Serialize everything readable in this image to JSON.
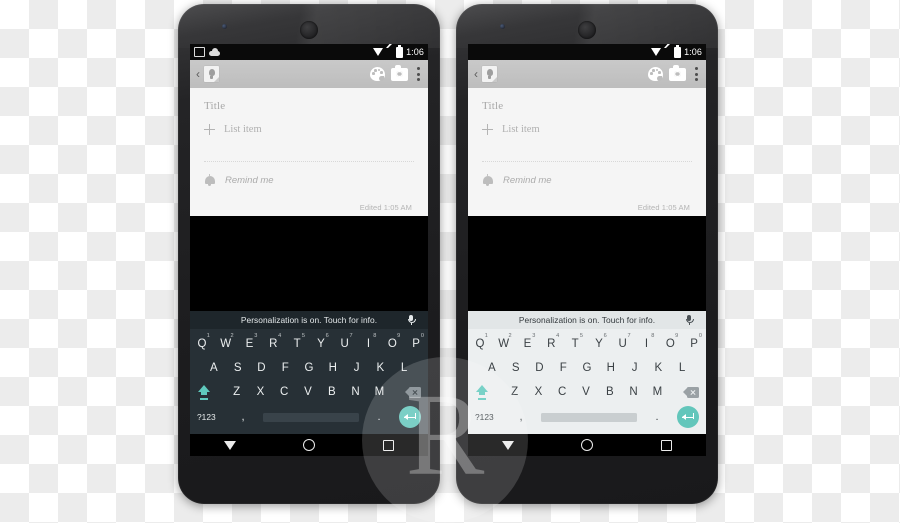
{
  "scene": {
    "description": "Two Android Nexus phones side by side showing Google Keep note editor with keyboard",
    "watermark_letter": "R"
  },
  "statusbar": {
    "clock": "1:06",
    "left_icons": [
      "image-icon",
      "cloud-icon"
    ],
    "right_icons": [
      "wifi-icon",
      "signal-icon",
      "battery-icon"
    ]
  },
  "appbar": {
    "back_label": "‹",
    "icons": [
      "note-bulb-icon",
      "palette-icon",
      "camera-icon",
      "overflow-menu-icon"
    ]
  },
  "note": {
    "title_placeholder": "Title",
    "list_item_placeholder": "List item",
    "remind_placeholder": "Remind me",
    "edited_label": "Edited 1:05 AM"
  },
  "keyboard": {
    "suggestion_text": "Personalization is on. Touch for info.",
    "mic_icon": "microphone-icon",
    "row1": [
      {
        "key": "Q",
        "num": "1"
      },
      {
        "key": "W",
        "num": "2"
      },
      {
        "key": "E",
        "num": "3"
      },
      {
        "key": "R",
        "num": "4"
      },
      {
        "key": "T",
        "num": "5"
      },
      {
        "key": "Y",
        "num": "6"
      },
      {
        "key": "U",
        "num": "7"
      },
      {
        "key": "I",
        "num": "8"
      },
      {
        "key": "O",
        "num": "9"
      },
      {
        "key": "P",
        "num": "0"
      }
    ],
    "row2": [
      "A",
      "S",
      "D",
      "F",
      "G",
      "H",
      "J",
      "K",
      "L"
    ],
    "row3": [
      "Z",
      "X",
      "C",
      "V",
      "B",
      "N",
      "M"
    ],
    "shift_icon": "shift-icon",
    "backspace_icon": "backspace-icon",
    "symbols_label": "?123",
    "comma_label": ",",
    "period_label": ".",
    "space_label": "",
    "enter_icon": "enter-icon",
    "accent_color": "#62c6bb",
    "dark_bg": "#273036",
    "light_bg": "#eceff0"
  },
  "navbar": {
    "items": [
      "back-triangle-icon",
      "home-circle-icon",
      "recents-square-icon"
    ]
  },
  "phones": [
    {
      "id": "left",
      "keyboard_theme": "dark",
      "statusbar_left_icons": true
    },
    {
      "id": "right",
      "keyboard_theme": "light",
      "statusbar_left_icons": false
    }
  ]
}
